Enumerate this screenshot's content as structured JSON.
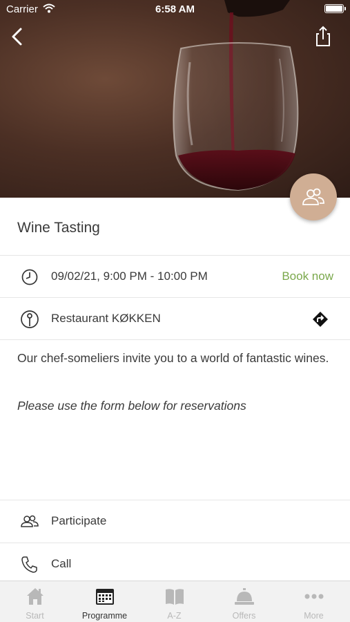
{
  "status_bar": {
    "carrier": "Carrier",
    "time": "6:58 AM"
  },
  "event": {
    "title": "Wine Tasting",
    "datetime": "09/02/21, 9:00 PM - 10:00 PM",
    "book_label": "Book now",
    "location": "Restaurant KØKKEN",
    "description": "Our chef-someliers invite you to a world of fantastic wines.",
    "note": "Please use the form below for reservations"
  },
  "actions": {
    "participate": "Participate",
    "call": "Call"
  },
  "tabs": [
    {
      "label": "Start",
      "icon": "home-icon"
    },
    {
      "label": "Programme",
      "icon": "calendar-icon"
    },
    {
      "label": "A-Z",
      "icon": "book-icon"
    },
    {
      "label": "Offers",
      "icon": "service-bell-icon"
    },
    {
      "label": "More",
      "icon": "more-icon"
    }
  ],
  "colors": {
    "accent": "#d0ae94",
    "book_link": "#7aa84b"
  }
}
